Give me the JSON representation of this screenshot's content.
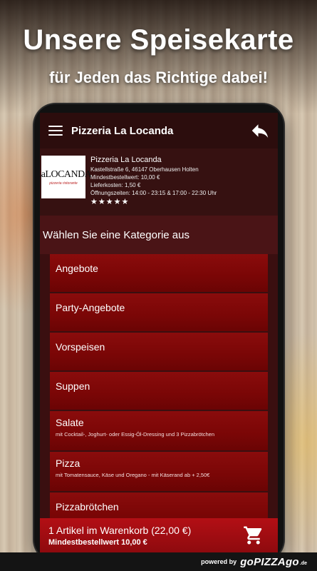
{
  "promo": {
    "headline": "Unsere Speisekarte",
    "subline": "für Jeden das Richtige dabei!"
  },
  "appbar": {
    "title": "Pizzeria La Locanda",
    "menu_icon": "hamburger-menu-icon",
    "back_icon": "reply-arrow-icon"
  },
  "restaurant": {
    "logo_text": "LaLOCANDA",
    "logo_subtext": "pizzeria ristorante",
    "name": "Pizzeria La Locanda",
    "address": "Kastellstraße 6, 46147 Oberhausen Holten",
    "min_order": "Mindestbestellwert: 10,00 €",
    "delivery_cost": "Lieferkosten: 1,50 €",
    "hours": "Öffnungszeiten: 14:00 - 23:15 & 17:00 - 22:30 Uhr",
    "rating": 5
  },
  "category_header": "Wählen Sie eine Kategorie aus",
  "categories": [
    {
      "title": "Angebote",
      "desc": ""
    },
    {
      "title": "Party-Angebote",
      "desc": ""
    },
    {
      "title": "Vorspeisen",
      "desc": ""
    },
    {
      "title": "Suppen",
      "desc": ""
    },
    {
      "title": "Salate",
      "desc": "mit Cocktail-, Joghurt- oder Essig-Öl-Dressing und 3 Pizzabrötchen"
    },
    {
      "title": "Pizza",
      "desc": "mit Tomatensauce, Käse und Oregano - mit Käserand ab + 2,50€"
    },
    {
      "title": "Pizzabrötchen",
      "desc": ""
    }
  ],
  "cart": {
    "summary": "1 Artikel im Warenkorb (22,00 €)",
    "min_order": "Mindestbestellwert 10,00 €",
    "icon": "shopping-cart-icon"
  },
  "footer": {
    "powered_by": "powered by",
    "brand": "goPIZZAgo",
    "brand_tld": ".de"
  },
  "colors": {
    "accent_red": "#8a0c0c",
    "appbar": "#2c0d0d",
    "cart_bar": "#b30f15"
  }
}
